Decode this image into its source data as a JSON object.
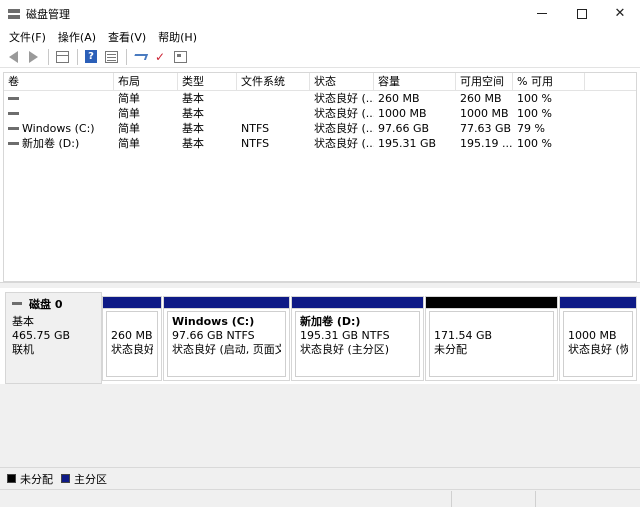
{
  "window": {
    "title": "磁盘管理"
  },
  "menu": [
    "文件(F)",
    "操作(A)",
    "查看(V)",
    "帮助(H)"
  ],
  "toolbar": {
    "help_glyph": "?"
  },
  "volume_table": {
    "columns": [
      "卷",
      "布局",
      "类型",
      "文件系统",
      "状态",
      "容量",
      "可用空间",
      "% 可用"
    ],
    "rows": [
      [
        "",
        "简单",
        "基本",
        "",
        "状态良好 (...",
        "260 MB",
        "260 MB",
        "100 %"
      ],
      [
        "",
        "简单",
        "基本",
        "",
        "状态良好 (...",
        "1000 MB",
        "1000 MB",
        "100 %"
      ],
      [
        "Windows (C:)",
        "简单",
        "基本",
        "NTFS",
        "状态良好 (...",
        "97.66 GB",
        "77.63 GB",
        "79 %"
      ],
      [
        "新加卷 (D:)",
        "简单",
        "基本",
        "NTFS",
        "状态良好 (...",
        "195.31 GB",
        "195.19 ...",
        "100 %"
      ]
    ]
  },
  "disk": {
    "name": "磁盘 0",
    "type": "基本",
    "size": "465.75 GB",
    "status": "联机"
  },
  "partitions": [
    {
      "name": "",
      "size": "260 MB",
      "status": "状态良好 ("
    },
    {
      "name": "Windows  (C:)",
      "size": "97.66 GB NTFS",
      "status": "状态良好 (启动, 页面文件"
    },
    {
      "name": "新加卷  (D:)",
      "size": "195.31 GB NTFS",
      "status": "状态良好 (主分区)"
    },
    {
      "name": "",
      "size": "171.54 GB",
      "status": "未分配"
    },
    {
      "name": "",
      "size": "1000 MB",
      "status": "状态良好 (恢复"
    }
  ],
  "legend": {
    "unallocated": "未分配",
    "primary": "主分区"
  },
  "colors": {
    "primary": "#0e1a86",
    "unallocated": "#000000",
    "chrome": "#f0f0f0"
  }
}
